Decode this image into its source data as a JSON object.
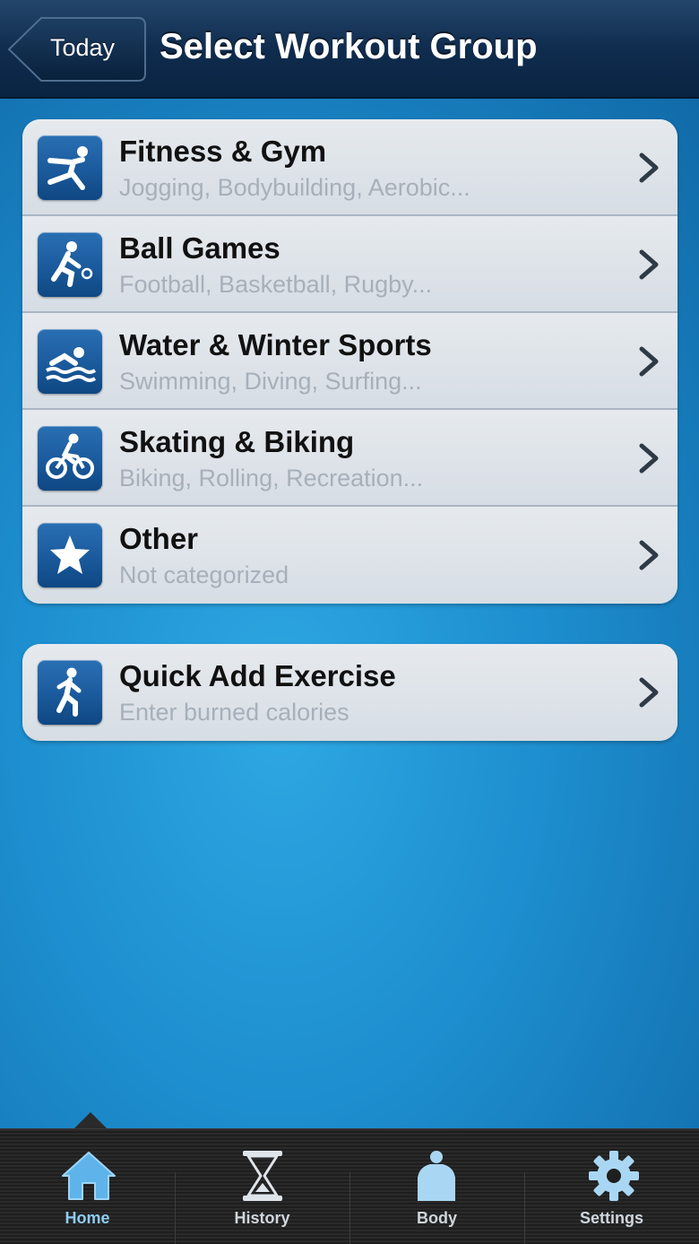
{
  "navbar": {
    "back_label": "Today",
    "title": "Select Workout Group"
  },
  "groups": [
    {
      "title": "Fitness & Gym",
      "subtitle": "Jogging, Bodybuilding, Aerobic...",
      "icon": "fitness-icon"
    },
    {
      "title": "Ball Games",
      "subtitle": "Football, Basketball, Rugby...",
      "icon": "ball-games-icon"
    },
    {
      "title": "Water & Winter Sports",
      "subtitle": "Swimming, Diving, Surfing...",
      "icon": "swimmer-icon"
    },
    {
      "title": "Skating & Biking",
      "subtitle": "Biking, Rolling, Recreation...",
      "icon": "cyclist-icon"
    },
    {
      "title": "Other",
      "subtitle": "Not categorized",
      "icon": "star-icon"
    }
  ],
  "quick_add": {
    "title": "Quick Add Exercise",
    "subtitle": "Enter burned calories",
    "icon": "runner-icon"
  },
  "tabbar": {
    "active": "Home",
    "tabs": [
      {
        "label": "Home",
        "icon": "home-icon"
      },
      {
        "label": "History",
        "icon": "hourglass-icon"
      },
      {
        "label": "Body",
        "icon": "body-icon"
      },
      {
        "label": "Settings",
        "icon": "gear-icon"
      }
    ]
  },
  "colors": {
    "navbar": "#0f2c4e",
    "background": "#1d8ecf",
    "icon_blue": "#1a5a9c",
    "subtitle_gray": "#a7b0ba",
    "active_tab": "#8fcbf2"
  }
}
